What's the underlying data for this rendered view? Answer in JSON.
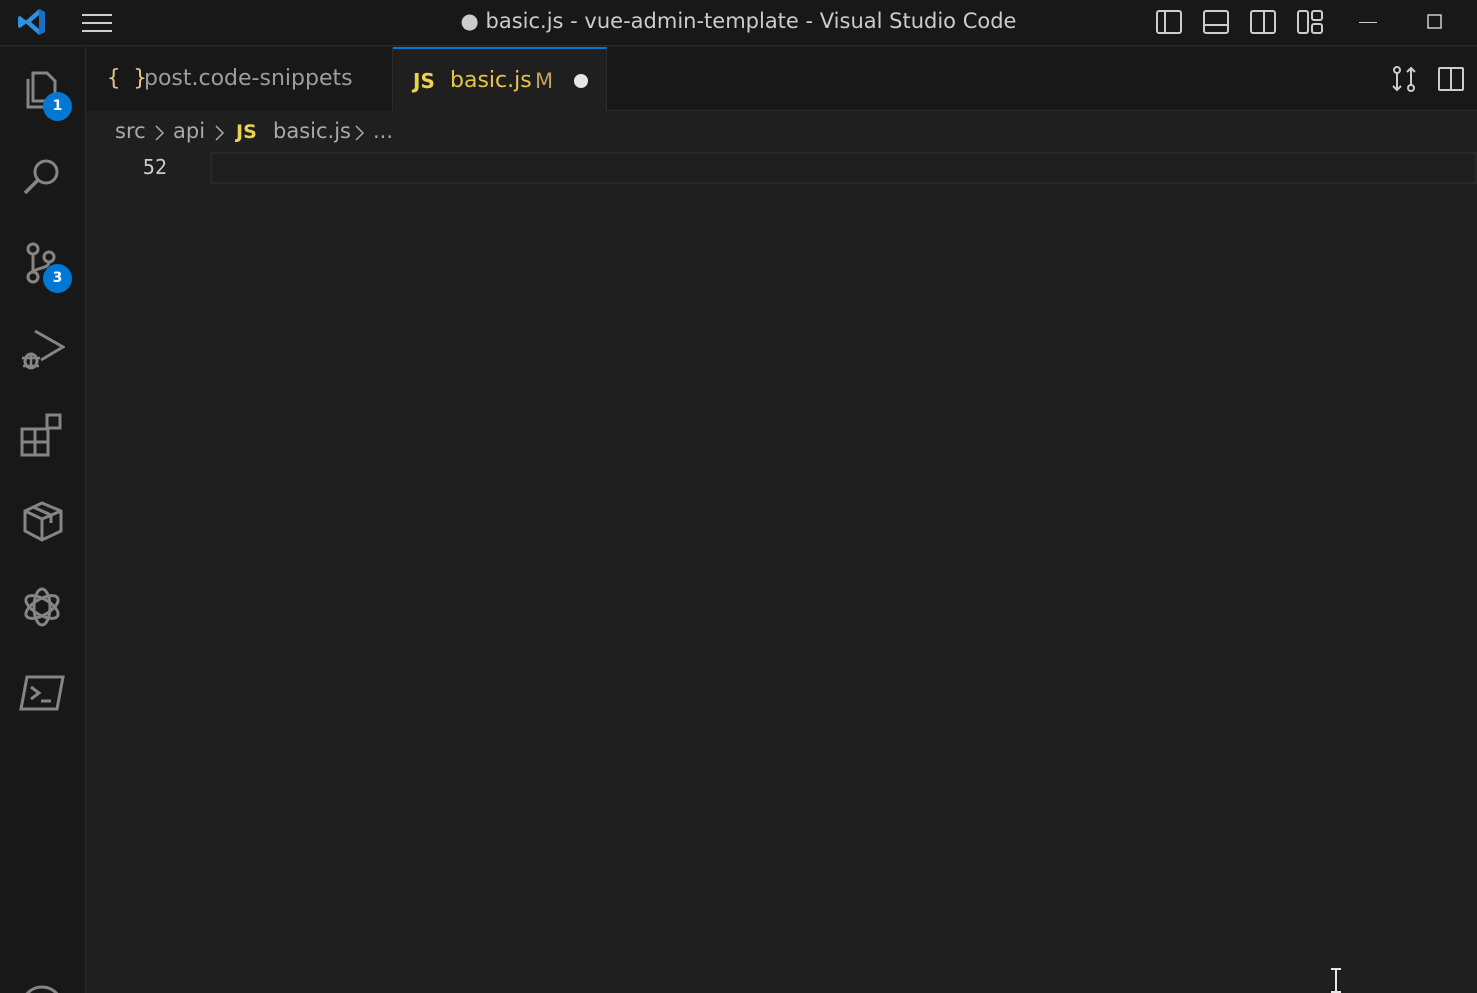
{
  "window": {
    "title": "● basic.js - vue-admin-template - Visual Studio Code"
  },
  "activity_bar": {
    "items": [
      {
        "name": "explorer",
        "icon": "files-icon",
        "badge": "1"
      },
      {
        "name": "search",
        "icon": "search-icon"
      },
      {
        "name": "source-control",
        "icon": "source-control-icon",
        "badge": "3"
      },
      {
        "name": "run-and-debug",
        "icon": "run-debug-icon"
      },
      {
        "name": "extensions",
        "icon": "extensions-icon"
      },
      {
        "name": "remote-explorer",
        "icon": "package-icon"
      },
      {
        "name": "chatgpt",
        "icon": "openai-icon"
      },
      {
        "name": "terminal",
        "icon": "terminal-icon"
      },
      {
        "name": "accounts",
        "icon": "account-icon"
      }
    ]
  },
  "tabs": [
    {
      "icon": "{ }",
      "label": "post.code-snippets",
      "active": false
    },
    {
      "icon": "JS",
      "label": "basic.js",
      "status": "M",
      "dirty": true,
      "active": true
    }
  ],
  "breadcrumb": {
    "parts": [
      "src",
      "api",
      "basic.js",
      "..."
    ],
    "file_icon": "JS"
  },
  "editor": {
    "line_number": "52",
    "content": ""
  },
  "colors": {
    "accent": "#0078d4",
    "js_icon": "#e8d44d",
    "modified": "#c2a15c",
    "background": "#1f1f1f",
    "chrome": "#181818"
  }
}
